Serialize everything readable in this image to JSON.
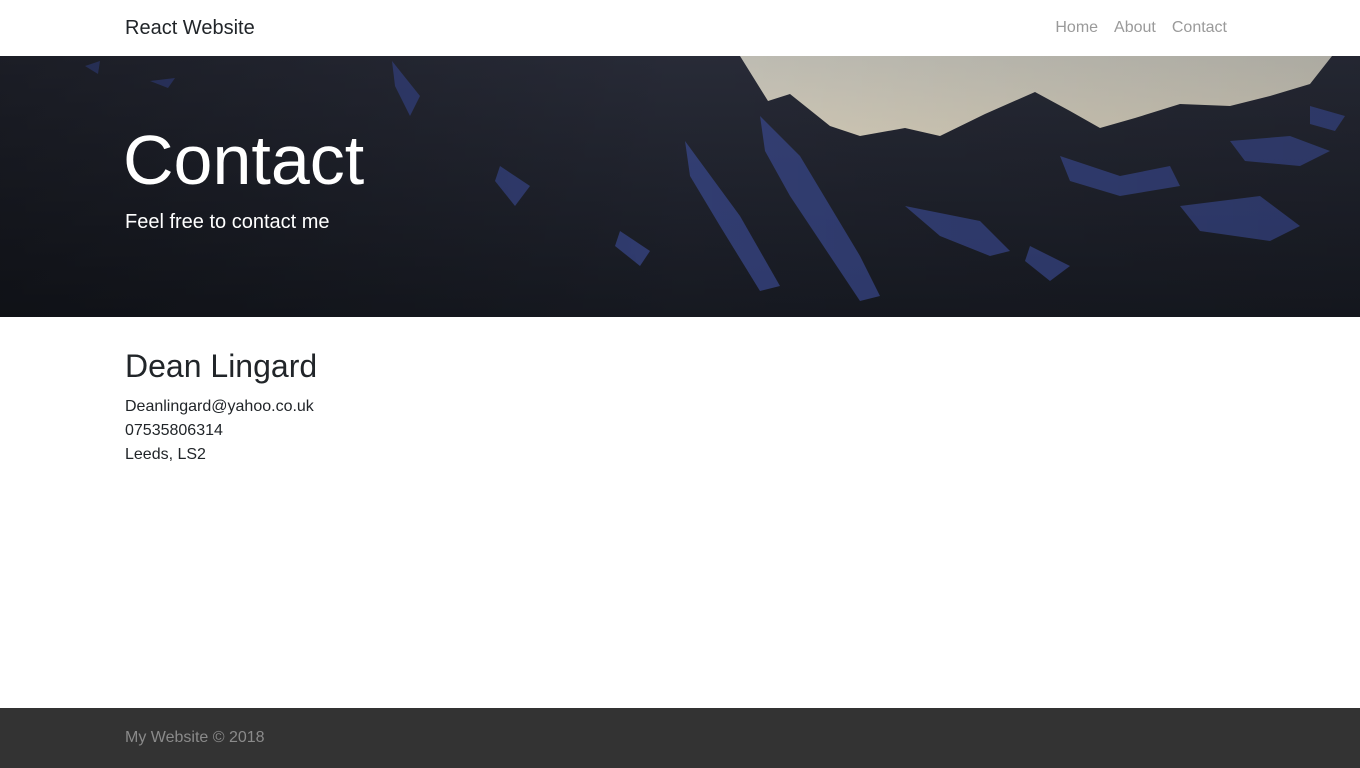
{
  "navbar": {
    "brand": "React Website",
    "links": [
      {
        "label": "Home"
      },
      {
        "label": "About"
      },
      {
        "label": "Contact"
      }
    ]
  },
  "hero": {
    "title": "Contact",
    "subtitle": "Feel free to contact me",
    "background": "mountain-landscape-image"
  },
  "contact": {
    "name": "Dean Lingard",
    "email": "Deanlingard@yahoo.co.uk",
    "phone": "07535806314",
    "location": "Leeds, LS2"
  },
  "footer": {
    "text": "My Website © 2018"
  },
  "colors": {
    "footer_bg": "#333333",
    "nav_link": "#9a9a9a",
    "hero_text": "#ffffff"
  }
}
